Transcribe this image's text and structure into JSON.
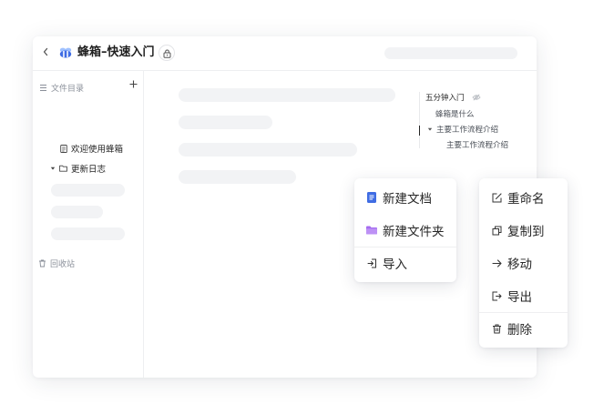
{
  "header": {
    "back_icon": "chevron-left-icon",
    "title": "蜂箱–快速入门",
    "lock_icon": "lock-icon"
  },
  "sidebar": {
    "directory_label": "文件目录",
    "add_icon": "plus-icon",
    "items": [
      {
        "label": "欢迎使用蜂箱",
        "icon": "document-icon"
      },
      {
        "label": "更新日志",
        "icon": "folder-icon"
      }
    ],
    "trash_label": "回收站"
  },
  "toc": {
    "items": [
      {
        "label": "五分钟入门"
      },
      {
        "label": "蜂箱是什么"
      },
      {
        "label": "主要工作流程介绍"
      },
      {
        "label": "主要工作流程介绍"
      }
    ]
  },
  "create_menu": {
    "items": [
      {
        "label": "新建文档",
        "icon": "document-icon",
        "color": "#3f6ce3"
      },
      {
        "label": "新建文件夹",
        "icon": "folder-icon",
        "color": "#a56cf0"
      },
      {
        "label": "导入",
        "icon": "import-icon"
      }
    ]
  },
  "action_menu": {
    "items": [
      {
        "label": "重命名",
        "icon": "edit-icon"
      },
      {
        "label": "复制到",
        "icon": "copy-icon"
      },
      {
        "label": "移动",
        "icon": "arrow-right-icon"
      },
      {
        "label": "导出",
        "icon": "export-icon"
      },
      {
        "label": "删除",
        "icon": "trash-icon"
      }
    ]
  },
  "colors": {
    "accent_blue": "#3f6ce3",
    "accent_purple": "#a56cf0"
  }
}
